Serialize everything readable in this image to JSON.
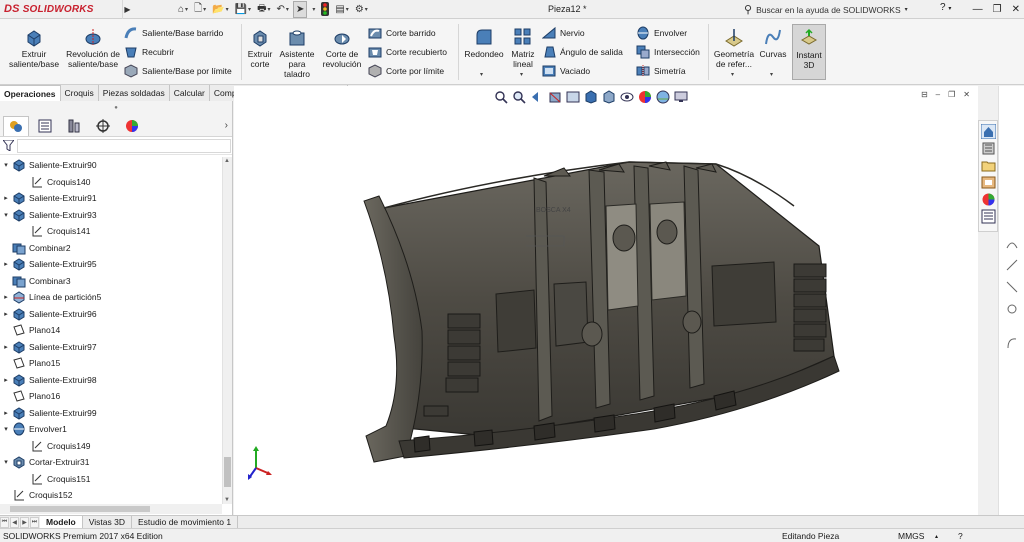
{
  "app": {
    "brand": "SOLIDWORKS",
    "brand_prefix": "DS",
    "document_title": "Pieza12 *",
    "search_placeholder": "Buscar en la ayuda de SOLIDWORKS",
    "help_label": "?",
    "colors": {
      "brand": "#c8202e",
      "model": "#4d4a43",
      "viewport_bg": "#ffffff",
      "ribbon_bg": "#f5f5f5"
    }
  },
  "ribbon": {
    "extruir_saliente": "Extruir saliente/base",
    "revolucion_saliente": "Revolución de saliente/base",
    "saliente_barrido": "Saliente/Base barrido",
    "recubrir": "Recubrir",
    "saliente_limite": "Saliente/Base por límite",
    "extruir_corte": "Extruir corte",
    "asistente_taladro": "Asistente para taladro",
    "corte_revolucion": "Corte de revolución",
    "corte_barrido": "Corte barrido",
    "corte_recubierto": "Corte recubierto",
    "corte_limite": "Corte por límite",
    "redondeo": "Redondeo",
    "matriz_lineal": "Matriz lineal",
    "nervio": "Nervio",
    "angulo_salida": "Ángulo de salida",
    "vaciado": "Vaciado",
    "envolver": "Envolver",
    "interseccion": "Intersección",
    "simetria": "Simetría",
    "geometria_referencia": "Geometría de refer...",
    "curvas": "Curvas",
    "instant3d": "Instant 3D"
  },
  "command_tabs": [
    "Operaciones",
    "Croquis",
    "Piezas soldadas",
    "Calcular",
    "Complementos de SOLIDWORKS"
  ],
  "feature_tree": [
    {
      "label": "Saliente-Extruir90",
      "icon": "extrude-icon",
      "expand": "▾",
      "indent": 0
    },
    {
      "label": "Croquis140",
      "icon": "sketch-icon",
      "expand": "",
      "indent": 1
    },
    {
      "label": "Saliente-Extruir91",
      "icon": "extrude-icon",
      "expand": "▸",
      "indent": 0
    },
    {
      "label": "Saliente-Extruir93",
      "icon": "extrude-icon",
      "expand": "▾",
      "indent": 0
    },
    {
      "label": "Croquis141",
      "icon": "sketch-icon",
      "expand": "",
      "indent": 1
    },
    {
      "label": "Combinar2",
      "icon": "combine-icon",
      "expand": "",
      "indent": 0
    },
    {
      "label": "Saliente-Extruir95",
      "icon": "extrude-icon",
      "expand": "▸",
      "indent": 0
    },
    {
      "label": "Combinar3",
      "icon": "combine-icon",
      "expand": "",
      "indent": 0
    },
    {
      "label": "Línea de partición5",
      "icon": "split-line-icon",
      "expand": "▸",
      "indent": 0
    },
    {
      "label": "Saliente-Extruir96",
      "icon": "extrude-icon",
      "expand": "▸",
      "indent": 0
    },
    {
      "label": "Plano14",
      "icon": "plane-icon",
      "expand": "",
      "indent": 0
    },
    {
      "label": "Saliente-Extruir97",
      "icon": "extrude-icon",
      "expand": "▸",
      "indent": 0
    },
    {
      "label": "Plano15",
      "icon": "plane-icon",
      "expand": "",
      "indent": 0
    },
    {
      "label": "Saliente-Extruir98",
      "icon": "extrude-icon",
      "expand": "▸",
      "indent": 0
    },
    {
      "label": "Plano16",
      "icon": "plane-icon",
      "expand": "",
      "indent": 0
    },
    {
      "label": "Saliente-Extruir99",
      "icon": "extrude-icon",
      "expand": "▸",
      "indent": 0
    },
    {
      "label": "Envolver1",
      "icon": "wrap-icon",
      "expand": "▾",
      "indent": 0
    },
    {
      "label": "Croquis149",
      "icon": "sketch-icon",
      "expand": "",
      "indent": 1
    },
    {
      "label": "Cortar-Extruir31",
      "icon": "cut-extrude-icon",
      "expand": "▾",
      "indent": 0
    },
    {
      "label": "Croquis151",
      "icon": "sketch-icon",
      "expand": "",
      "indent": 1
    },
    {
      "label": "Croquis152",
      "icon": "sketch-icon",
      "expand": "",
      "indent": 0
    }
  ],
  "bottom_tabs": [
    "Modelo",
    "Vistas 3D",
    "Estudio de movimiento 1"
  ],
  "status": {
    "edition": "SOLIDWORKS Premium 2017 x64 Edition",
    "mode": "Editando Pieza",
    "units": "MMGS"
  },
  "viewport": {
    "sketch_label": "BOSCA X4"
  }
}
